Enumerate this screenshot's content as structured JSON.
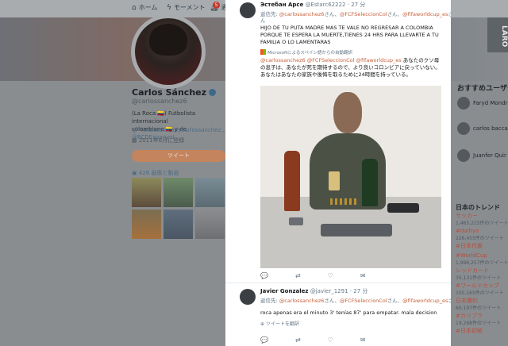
{
  "background": {
    "nav": {
      "home_label": "ホーム",
      "moments_label": "モーメント",
      "notifications_label": "通知",
      "notification_count": "5"
    },
    "profile": {
      "name": "Carlos Sánchez",
      "handle": "@carlossanchez6",
      "bio_line1": "(La Roca 🇨🇴) Futbolista internacional",
      "bio_line2_prefix": "colombiano 🇨🇴 y de ",
      "bio_line2_link": "@RCDEspanyol",
      "website": "facebook.com/carlossanchez...",
      "joined": "2011年6月に登録",
      "tweet_button": "ツイート",
      "media_label": "426 画像と動画"
    },
    "sidebar": {
      "title": "おすすめユーザー",
      "users": [
        {
          "name": "Faryd Mondr"
        },
        {
          "name": "carlos bacca"
        },
        {
          "name": "Juanfer Quir"
        }
      ],
      "trends_title": "日本のトレンド",
      "trends": [
        {
          "name": "サッカー",
          "count": "1,465,215件のツイート"
        },
        {
          "name": "#daihyo",
          "count": "226,455件のツイート"
        },
        {
          "name": "#日本代表",
          "count": ""
        },
        {
          "name": "#WorldCup",
          "count": "1,996,257件のツイート"
        },
        {
          "name": "レッドカード",
          "count": "35,131件のツイート"
        },
        {
          "name": "#ワールドカップ",
          "count": "105,165件のツイート"
        },
        {
          "name": "日本勝利",
          "count": "60,197件のツイート"
        },
        {
          "name": "#カリブラ",
          "count": "19,268件のツイート"
        },
        {
          "name": "#日本初戦",
          "count": ""
        }
      ],
      "corner_label": "LARO"
    }
  },
  "modal": {
    "tweet1": {
      "name": "Эстебан Арсе",
      "handle": "@Estarc62222",
      "time": "27 分",
      "reply_prefix": "返信先: ",
      "reply_mentions": [
        "@carlossanchez6",
        "@FCFSeleccionCol",
        "@fifaworldcup_es"
      ],
      "reply_suffix_1": "さん、",
      "reply_suffix_2": "さん、",
      "reply_suffix_3": "さ",
      "reply_end": "ん",
      "text": "HIJO DE TU PUTA MADRE MAS TE VALE NO REGRESAR A COLOMBIA PORQUE TE ESPERA LA MUERTE,TIENES 24 HRS PARA LLEVARTE A TU FAMILIA O LO LAMENTARAS",
      "translation_label": "Microsoftによるスペイン語からの自動翻訳",
      "translated_mentions": "@carlossanchez6 @FCFSeleccionCol @fifaworldcup_es",
      "translated_text": " あなたのクソ母の息子は、あなたが死を期待するので、より良いコロンビアに戻っていない。あなたはあなたの家族や後悔を取るために24時間を持っている。",
      "photo_alt": "attached photo"
    },
    "tweet2": {
      "name": "Javier Gonzalez",
      "handle": "@javier_1291",
      "time": "27 分",
      "reply_prefix": "返信先: ",
      "reply_mention_1": "@carlossanchez6",
      "reply_mention_2": "@FCFSeleccionCol",
      "reply_mention_3": "@fifaworldcup_es",
      "reply_suffix_1": "さん、",
      "reply_suffix_2": "さん、",
      "reply_suffix_3": "さん",
      "text": "roca apenas era el minuto 3' tenías 87' para empatar. mala decision",
      "translate_link": "ツイートを翻訳"
    },
    "actions": {
      "reply_icon": "💬",
      "retweet_icon": "⇄",
      "like_icon": "♡",
      "mail_icon": "✉"
    }
  }
}
